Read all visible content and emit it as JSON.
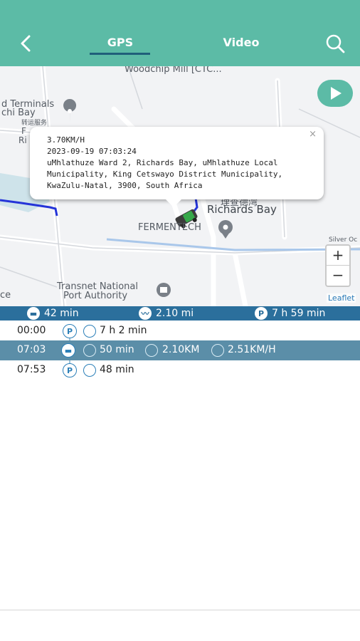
{
  "header": {
    "tabs": [
      {
        "label": "GPS",
        "active": true
      },
      {
        "label": "Video",
        "active": false
      }
    ],
    "colors": {
      "bar": "#5cbba6",
      "underline": "#1f5f7a"
    }
  },
  "map": {
    "labels": {
      "woodchip": "Woodchip Mill [CTC...",
      "terminals1": "d Terminals",
      "terminals2": "chi  Bay",
      "terminals3": "转运服务",
      "left_f": "F",
      "left_ri": "Ri",
      "richards_cn": "理查德湾",
      "richards": "Richards Bay",
      "fermentech": "FERMENTECH",
      "silver": "Silver Oc",
      "transnet1": "Transnet National",
      "transnet2": "Port Authority",
      "edge_ce": "ce"
    },
    "zoom_in": "+",
    "zoom_out": "−",
    "attribution": "Leaflet",
    "popup": {
      "speed": "3.70KM/H",
      "datetime": "2023-09-19 07:03:24",
      "address_line1": "uMhlathuze Ward 2, Richards Bay, uMhlathuze Local",
      "address_line2": "Municipality, King Cetswayo District Municipality,",
      "address_line3": "KwaZulu-Natal, 3900, South Africa",
      "close": "×"
    }
  },
  "summary": {
    "drive_time": "42 min",
    "distance": "2.10 mi",
    "park_time": "7 h 59 min"
  },
  "rows": [
    {
      "time": "00:00",
      "type": "P",
      "duration": "7 h 2 min"
    },
    {
      "time": "07:03",
      "type": "drive",
      "duration": "50 min",
      "distance": "2.10KM",
      "speed": "2.51KM/H"
    },
    {
      "time": "07:53",
      "type": "P",
      "duration": "48 min"
    }
  ]
}
